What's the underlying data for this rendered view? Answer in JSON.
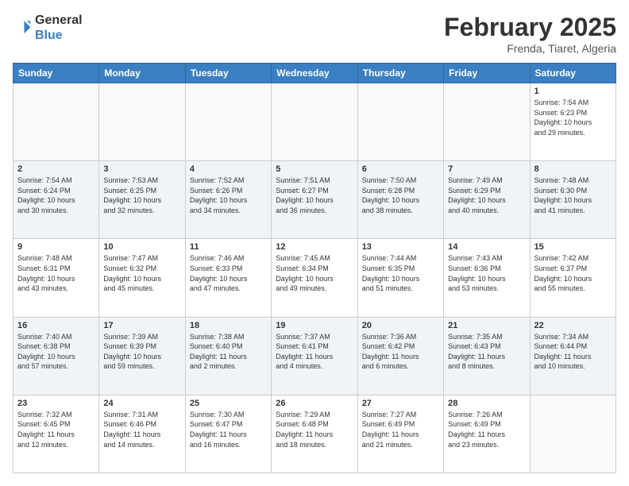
{
  "logo": {
    "line1": "General",
    "line2": "Blue"
  },
  "title": "February 2025",
  "subtitle": "Frenda, Tiaret, Algeria",
  "days_of_week": [
    "Sunday",
    "Monday",
    "Tuesday",
    "Wednesday",
    "Thursday",
    "Friday",
    "Saturday"
  ],
  "weeks": [
    {
      "alt": false,
      "days": [
        {
          "num": "",
          "info": ""
        },
        {
          "num": "",
          "info": ""
        },
        {
          "num": "",
          "info": ""
        },
        {
          "num": "",
          "info": ""
        },
        {
          "num": "",
          "info": ""
        },
        {
          "num": "",
          "info": ""
        },
        {
          "num": "1",
          "info": "Sunrise: 7:54 AM\nSunset: 6:23 PM\nDaylight: 10 hours\nand 29 minutes."
        }
      ]
    },
    {
      "alt": true,
      "days": [
        {
          "num": "2",
          "info": "Sunrise: 7:54 AM\nSunset: 6:24 PM\nDaylight: 10 hours\nand 30 minutes."
        },
        {
          "num": "3",
          "info": "Sunrise: 7:53 AM\nSunset: 6:25 PM\nDaylight: 10 hours\nand 32 minutes."
        },
        {
          "num": "4",
          "info": "Sunrise: 7:52 AM\nSunset: 6:26 PM\nDaylight: 10 hours\nand 34 minutes."
        },
        {
          "num": "5",
          "info": "Sunrise: 7:51 AM\nSunset: 6:27 PM\nDaylight: 10 hours\nand 36 minutes."
        },
        {
          "num": "6",
          "info": "Sunrise: 7:50 AM\nSunset: 6:28 PM\nDaylight: 10 hours\nand 38 minutes."
        },
        {
          "num": "7",
          "info": "Sunrise: 7:49 AM\nSunset: 6:29 PM\nDaylight: 10 hours\nand 40 minutes."
        },
        {
          "num": "8",
          "info": "Sunrise: 7:48 AM\nSunset: 6:30 PM\nDaylight: 10 hours\nand 41 minutes."
        }
      ]
    },
    {
      "alt": false,
      "days": [
        {
          "num": "9",
          "info": "Sunrise: 7:48 AM\nSunset: 6:31 PM\nDaylight: 10 hours\nand 43 minutes."
        },
        {
          "num": "10",
          "info": "Sunrise: 7:47 AM\nSunset: 6:32 PM\nDaylight: 10 hours\nand 45 minutes."
        },
        {
          "num": "11",
          "info": "Sunrise: 7:46 AM\nSunset: 6:33 PM\nDaylight: 10 hours\nand 47 minutes."
        },
        {
          "num": "12",
          "info": "Sunrise: 7:45 AM\nSunset: 6:34 PM\nDaylight: 10 hours\nand 49 minutes."
        },
        {
          "num": "13",
          "info": "Sunrise: 7:44 AM\nSunset: 6:35 PM\nDaylight: 10 hours\nand 51 minutes."
        },
        {
          "num": "14",
          "info": "Sunrise: 7:43 AM\nSunset: 6:36 PM\nDaylight: 10 hours\nand 53 minutes."
        },
        {
          "num": "15",
          "info": "Sunrise: 7:42 AM\nSunset: 6:37 PM\nDaylight: 10 hours\nand 55 minutes."
        }
      ]
    },
    {
      "alt": true,
      "days": [
        {
          "num": "16",
          "info": "Sunrise: 7:40 AM\nSunset: 6:38 PM\nDaylight: 10 hours\nand 57 minutes."
        },
        {
          "num": "17",
          "info": "Sunrise: 7:39 AM\nSunset: 6:39 PM\nDaylight: 10 hours\nand 59 minutes."
        },
        {
          "num": "18",
          "info": "Sunrise: 7:38 AM\nSunset: 6:40 PM\nDaylight: 11 hours\nand 2 minutes."
        },
        {
          "num": "19",
          "info": "Sunrise: 7:37 AM\nSunset: 6:41 PM\nDaylight: 11 hours\nand 4 minutes."
        },
        {
          "num": "20",
          "info": "Sunrise: 7:36 AM\nSunset: 6:42 PM\nDaylight: 11 hours\nand 6 minutes."
        },
        {
          "num": "21",
          "info": "Sunrise: 7:35 AM\nSunset: 6:43 PM\nDaylight: 11 hours\nand 8 minutes."
        },
        {
          "num": "22",
          "info": "Sunrise: 7:34 AM\nSunset: 6:44 PM\nDaylight: 11 hours\nand 10 minutes."
        }
      ]
    },
    {
      "alt": false,
      "days": [
        {
          "num": "23",
          "info": "Sunrise: 7:32 AM\nSunset: 6:45 PM\nDaylight: 11 hours\nand 12 minutes."
        },
        {
          "num": "24",
          "info": "Sunrise: 7:31 AM\nSunset: 6:46 PM\nDaylight: 11 hours\nand 14 minutes."
        },
        {
          "num": "25",
          "info": "Sunrise: 7:30 AM\nSunset: 6:47 PM\nDaylight: 11 hours\nand 16 minutes."
        },
        {
          "num": "26",
          "info": "Sunrise: 7:29 AM\nSunset: 6:48 PM\nDaylight: 11 hours\nand 18 minutes."
        },
        {
          "num": "27",
          "info": "Sunrise: 7:27 AM\nSunset: 6:49 PM\nDaylight: 11 hours\nand 21 minutes."
        },
        {
          "num": "28",
          "info": "Sunrise: 7:26 AM\nSunset: 6:49 PM\nDaylight: 11 hours\nand 23 minutes."
        },
        {
          "num": "",
          "info": ""
        }
      ]
    }
  ]
}
